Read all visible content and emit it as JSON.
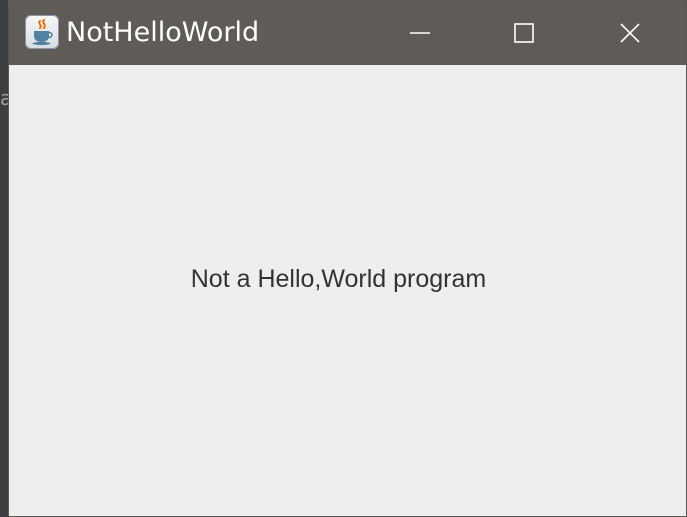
{
  "background": {
    "letter": "a",
    "colors": {
      "desktop": "#3c3f41",
      "letter": "#9aa0a4"
    }
  },
  "window": {
    "title": "NotHelloWorld",
    "icon": "java-coffee-icon",
    "controls": {
      "minimize_icon": "minimize-icon",
      "maximize_icon": "maximize-icon",
      "close_icon": "close-icon"
    },
    "colors": {
      "titlebar": "#5f5b56",
      "title_text": "#ffffff",
      "content_bg": "#eeeeee",
      "label_text": "#333333"
    }
  },
  "content": {
    "message": "Not a Hello,World program"
  }
}
